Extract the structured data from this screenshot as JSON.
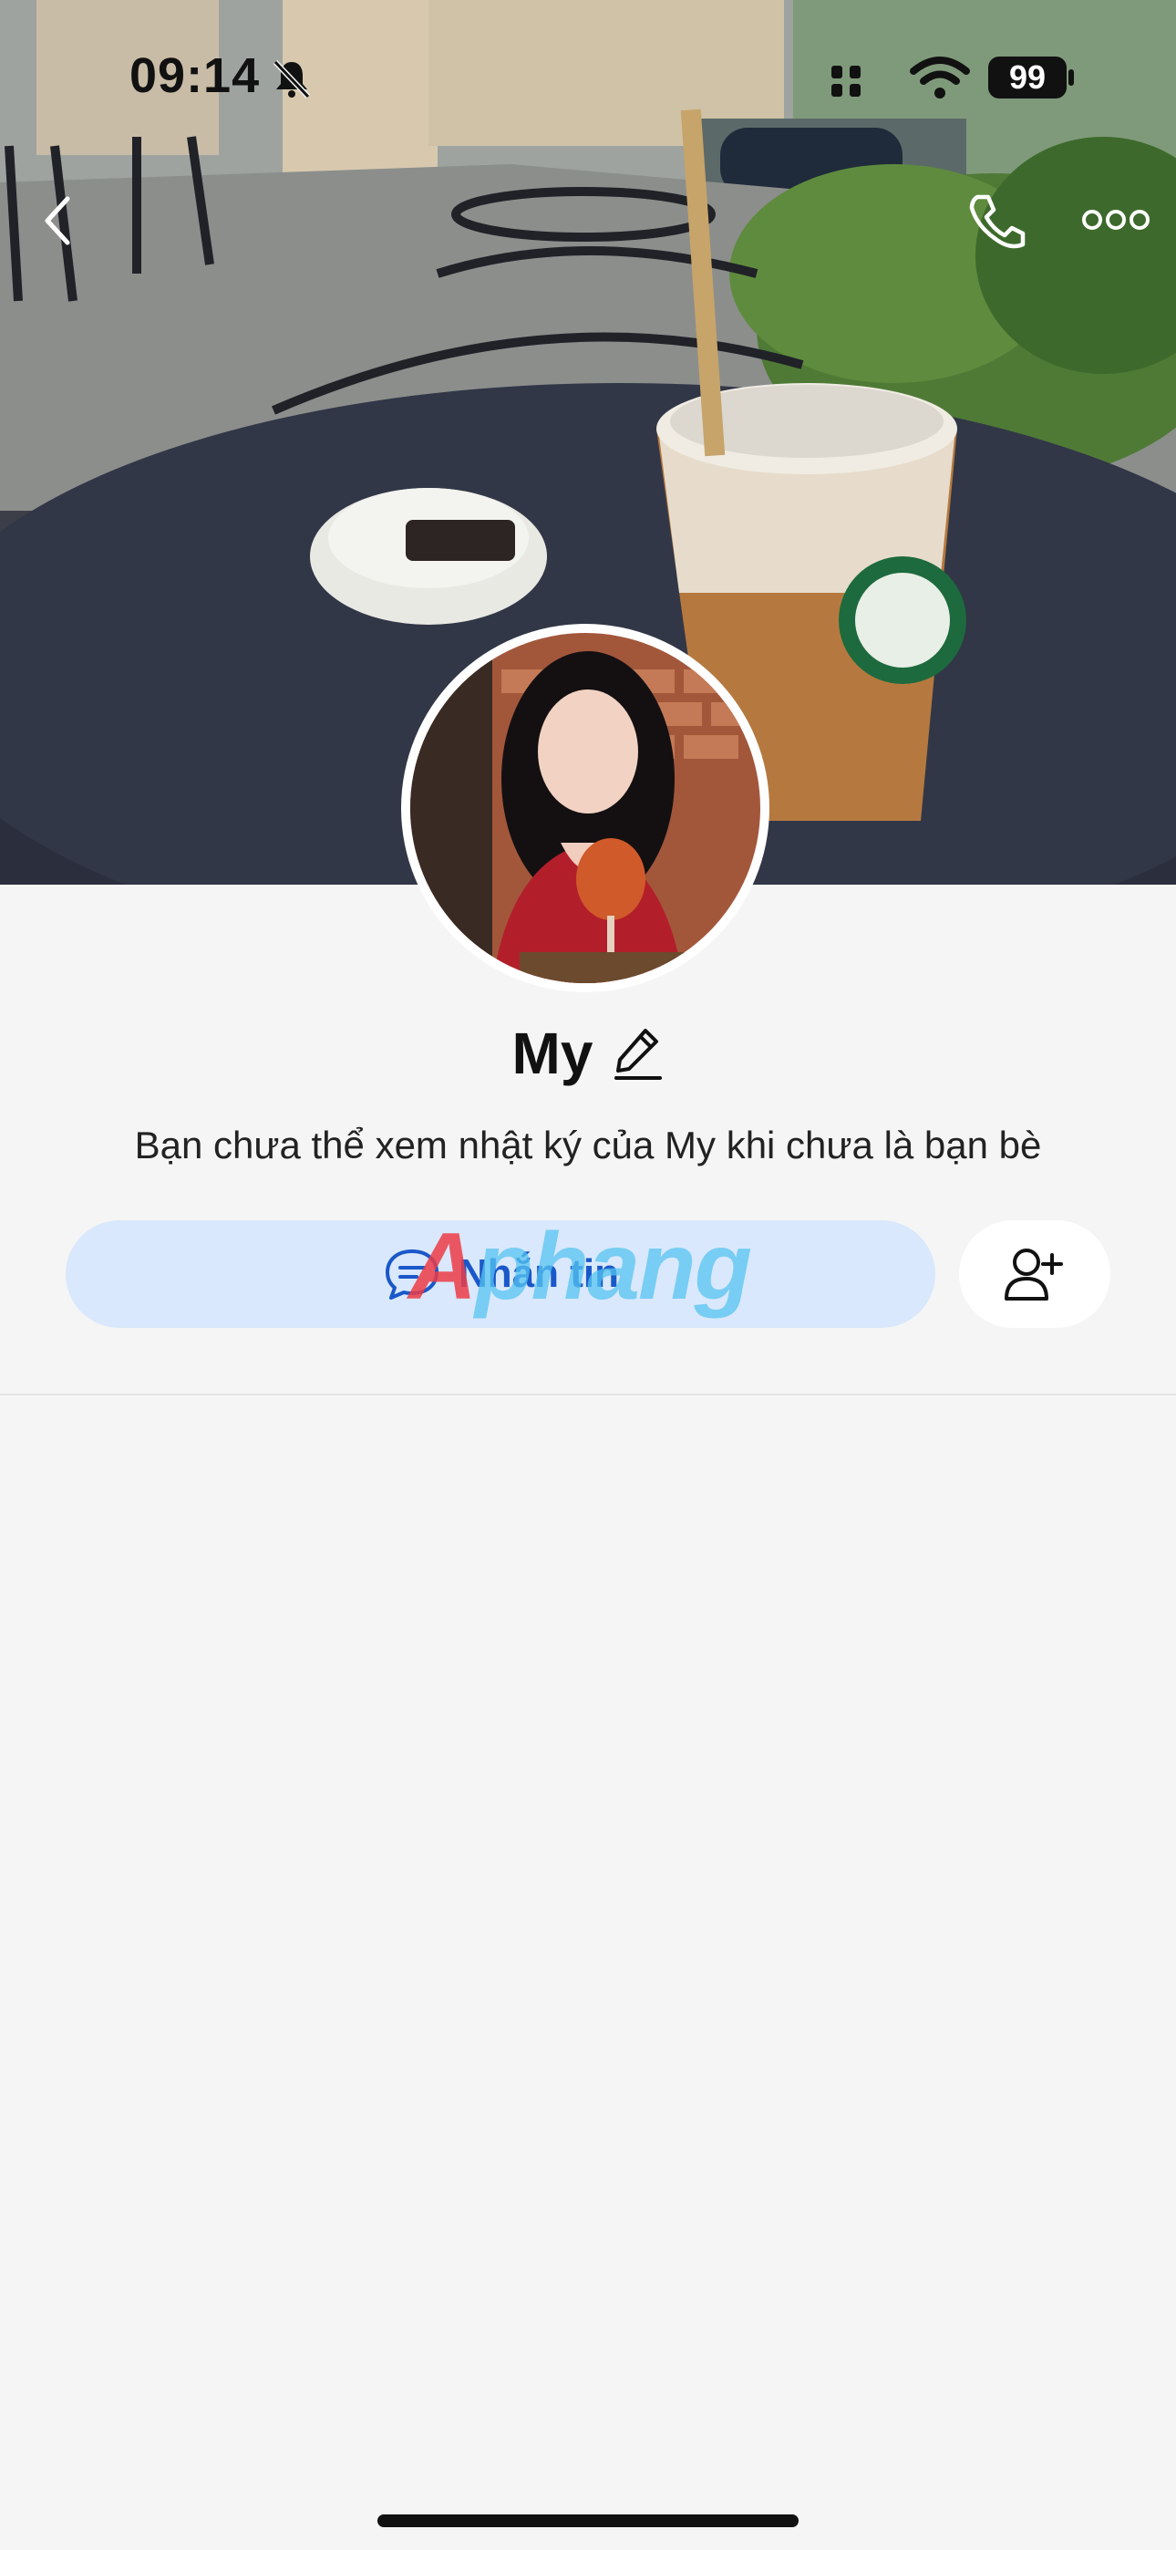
{
  "status_bar": {
    "time": "09:14",
    "battery": "99",
    "icons": [
      "bell-slash-icon",
      "signal-icon",
      "wifi-icon",
      "battery-icon"
    ]
  },
  "nav": {
    "icons": [
      "back-chevron-icon",
      "phone-icon",
      "more-dots-icon"
    ]
  },
  "profile": {
    "name": "My",
    "privacy_note": "Bạn chưa thể xem nhật ký của My khi chưa là bạn bè",
    "edit_icon": "pencil-icon"
  },
  "actions": {
    "message_label": "Nhắn tin",
    "message_icon": "chat-bubble-icon",
    "add_friend_icon": "add-user-icon"
  },
  "watermark": {
    "text_a": "A",
    "text_rest": "phang"
  },
  "colors": {
    "background": "#f5f5f5",
    "message_button_bg": "#d9e8fc",
    "message_button_text": "#1a58c9",
    "add_friend_bg": "#ffffff"
  }
}
